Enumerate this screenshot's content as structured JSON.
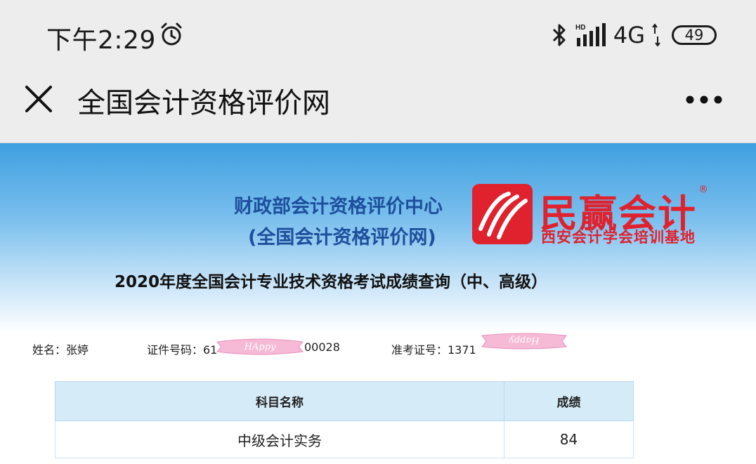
{
  "status_bar": {
    "time": "下午2:29",
    "network": "4G",
    "battery": "49"
  },
  "title_bar": {
    "title": "全国会计资格评价网"
  },
  "header": {
    "org_name": "财政部会计资格评价中心",
    "org_subname": "(全国会计资格评价网)",
    "logo": {
      "name": "民赢会计",
      "subtitle": "西安会计学会培训基地",
      "registered": "®",
      "color": "#e0212e"
    }
  },
  "query_title": "2020年度全国会计专业技术资格考试成绩查询（中、高级）",
  "candidate": {
    "name": "姓名：张婷",
    "id_number": "证件号码：61",
    "id_number_tail": "00028",
    "admission_number": "准考证号：1371"
  },
  "watermarks": [
    "HAppy",
    "Happy"
  ],
  "score_table": {
    "headers": [
      "科目名称",
      "成绩"
    ],
    "rows": [
      {
        "subject": "中级会计实务",
        "score": "84"
      }
    ]
  }
}
